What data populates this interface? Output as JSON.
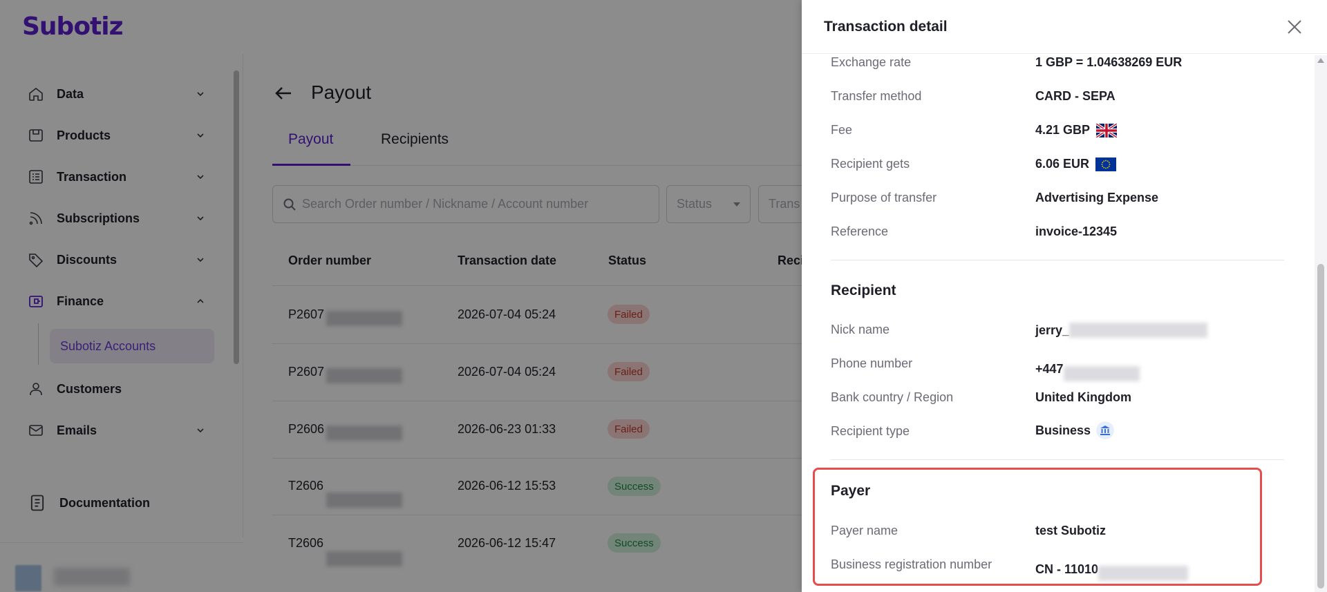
{
  "app": {
    "logo": "Subotiz"
  },
  "sidebar": {
    "items": [
      {
        "label": "Data",
        "icon": "home-icon"
      },
      {
        "label": "Products",
        "icon": "product-icon"
      },
      {
        "label": "Transaction",
        "icon": "list-icon"
      },
      {
        "label": "Subscriptions",
        "icon": "rss-icon"
      },
      {
        "label": "Discounts",
        "icon": "tag-icon"
      },
      {
        "label": "Finance",
        "icon": "wallet-icon"
      },
      {
        "label": "Customers",
        "icon": "user-icon"
      },
      {
        "label": "Emails",
        "icon": "mail-icon"
      }
    ],
    "sub_item": "Subotiz Accounts",
    "documentation": "Documentation"
  },
  "page": {
    "title": "Payout",
    "tabs": [
      "Payout",
      "Recipients"
    ],
    "search_placeholder": "Search Order number / Nickname / Account number",
    "status_placeholder": "Status",
    "type_placeholder": "Trans",
    "columns": [
      "Order number",
      "Transaction date",
      "Status",
      "Reci"
    ],
    "rows": [
      {
        "order": "P2607",
        "date": "2026-07-04 05:24",
        "status": "Failed"
      },
      {
        "order": "P2607",
        "date": "2026-07-04 05:24",
        "status": "Failed"
      },
      {
        "order": "P2606",
        "date": "2026-06-23 01:33",
        "status": "Failed"
      },
      {
        "order": "T2606",
        "date": "2026-06-12 15:53",
        "status": "Success"
      },
      {
        "order": "T2606",
        "date": "2026-06-12 15:47",
        "status": "Success"
      }
    ]
  },
  "drawer": {
    "title": "Transaction detail",
    "details": [
      {
        "label": "Exchange rate",
        "value": "1 GBP = 1.04638269 EUR"
      },
      {
        "label": "Transfer method",
        "value": "CARD - SEPA"
      },
      {
        "label": "Fee",
        "value": "4.21 GBP",
        "flag": "uk-flag-icon"
      },
      {
        "label": "Recipient gets",
        "value": "6.06 EUR",
        "flag": "eu-flag-icon"
      },
      {
        "label": "Purpose of transfer",
        "value": "Advertising Expense"
      },
      {
        "label": "Reference",
        "value": "invoice-12345"
      }
    ],
    "recipient": {
      "heading": "Recipient",
      "fields": [
        {
          "label": "Nick name",
          "value": "jerry_"
        },
        {
          "label": "Phone number",
          "value": "+447"
        },
        {
          "label": "Bank country / Region",
          "value": "United Kingdom"
        },
        {
          "label": "Recipient type",
          "value": "Business",
          "icon": "bank-icon"
        }
      ]
    },
    "payer": {
      "heading": "Payer",
      "fields": [
        {
          "label": "Payer name",
          "value": "test Subotiz"
        },
        {
          "label": "Business registration number",
          "value": "CN - 11010"
        }
      ]
    }
  },
  "colors": {
    "brand": "#5b1fd1",
    "highlight": "#e64d4d",
    "failed": "#c0392b",
    "success": "#1e8b4a"
  }
}
